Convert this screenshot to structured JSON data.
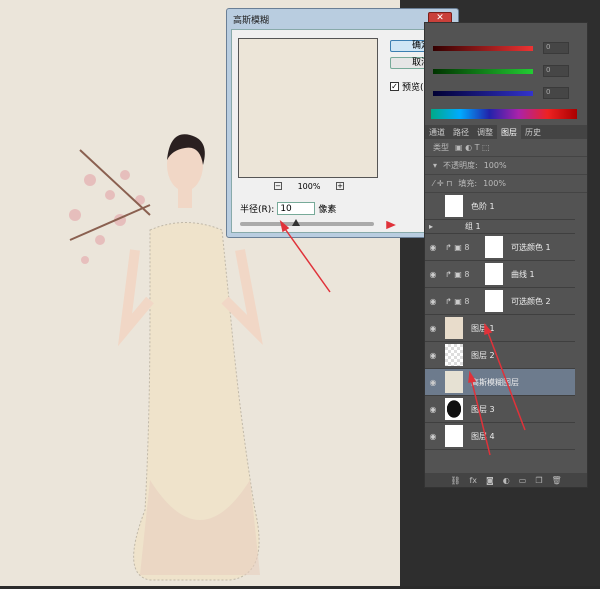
{
  "dialog": {
    "title": "高斯模糊",
    "close": "✕",
    "ok": "确定",
    "cancel": "取消",
    "preview_label": "预览(P)",
    "preview_checked": true,
    "zoom_level": "100%",
    "zoom_out": "−",
    "zoom_in": "+",
    "radius_label": "半径(R):",
    "radius_value": "10",
    "radius_unit": "像素"
  },
  "color_panel": {
    "r": "0",
    "g": "0",
    "b": "0"
  },
  "panel_tabs": [
    "通道",
    "路径",
    "调整",
    "图层",
    "历史"
  ],
  "layer_controls": {
    "opacity_label": "不透明度:",
    "opacity": "100%",
    "fill_label": "填充:",
    "fill": "100%",
    "filter": "类型"
  },
  "layers": [
    {
      "name": "色阶 1",
      "type": "adj"
    },
    {
      "name": "组 1",
      "type": "group"
    },
    {
      "name": "可选颜色 1",
      "type": "adj"
    },
    {
      "name": "曲线 1",
      "type": "adj"
    },
    {
      "name": "可选颜色 2",
      "type": "adj"
    },
    {
      "name": "图层 1",
      "type": "photo"
    },
    {
      "name": "图层 2",
      "type": "trans"
    },
    {
      "name": "高斯模糊图层",
      "type": "fill",
      "selected": true
    },
    {
      "name": "图层 3",
      "type": "dark"
    },
    {
      "name": "图层 4",
      "type": "white"
    }
  ],
  "colors": {
    "accent": "#e0323a",
    "selection": "#6d7b8d"
  }
}
